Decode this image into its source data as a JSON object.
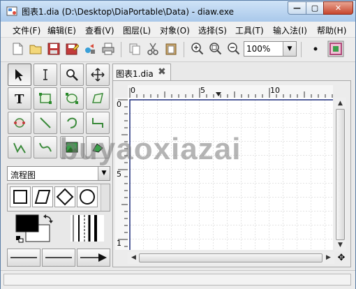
{
  "window": {
    "title": "图表1.dia (D:\\Desktop\\DiaPortable\\Data) - diaw.exe",
    "minimize_label": "—",
    "maximize_label": "▢",
    "close_label": "✕"
  },
  "menu": {
    "items": [
      "文件(F)",
      "编辑(E)",
      "查看(V)",
      "图层(L)",
      "对象(O)",
      "选择(S)",
      "工具(T)",
      "输入法(I)",
      "帮助(H)"
    ]
  },
  "toolbar": {
    "zoom_value": "100%"
  },
  "palette": {
    "sheet_selected": "流程图"
  },
  "tab": {
    "label": "图表1.dia"
  },
  "rulers": {
    "horizontal_ticks": [
      "0",
      "5",
      "10"
    ],
    "vertical_ticks": [
      "0",
      "5",
      "1"
    ]
  },
  "watermark": {
    "text": "buyaoxiazai"
  },
  "colors": {
    "foreground": "#000000",
    "background": "#ffffff",
    "accent": "#cfe3f7",
    "canvas_border": "#1a2a7a"
  }
}
